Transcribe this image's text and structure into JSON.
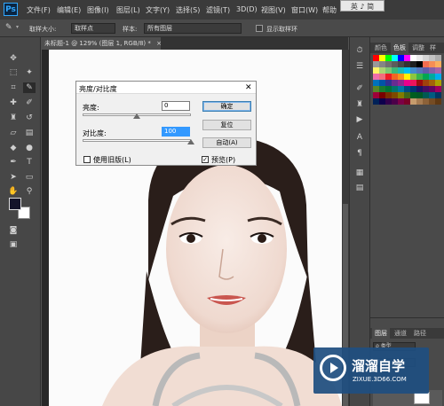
{
  "menubar": {
    "logo": "Ps",
    "items": [
      "文件(F)",
      "编辑(E)",
      "图像(I)",
      "图层(L)",
      "文字(Y)",
      "选择(S)",
      "滤镜(T)",
      "3D(D)",
      "视图(V)",
      "窗口(W)",
      "帮助"
    ],
    "tooltip": "英 ♪ 简"
  },
  "options": {
    "sample_size_label": "取样大小:",
    "sample_size_value": "取样点",
    "sample_label": "样本:",
    "sample_value": "所有图层",
    "show_ring_label": "显示取样环"
  },
  "document": {
    "tab_title": "未标题-1 @ 129% (图层 1, RGB/8) *",
    "tab_close": "×"
  },
  "swatches": {
    "tabs": [
      "颜色",
      "色板",
      "调整",
      "样式"
    ],
    "colors": [
      "#ff0000",
      "#ffff00",
      "#00ff00",
      "#00ffff",
      "#0000ff",
      "#ff00ff",
      "#ffffff",
      "#ebebeb",
      "#d6d6d6",
      "#c2c2c2",
      "#adadad",
      "#999999",
      "#858585",
      "#707070",
      "#5c5c5c",
      "#474747",
      "#333333",
      "#1f1f1f",
      "#000000",
      "#f26c4f",
      "#f68e55",
      "#fbaf5c",
      "#fff467",
      "#acd372",
      "#7dc473",
      "#3cb878",
      "#1abbb4",
      "#00bff3",
      "#438ccb",
      "#5574b9",
      "#605ca8",
      "#855fa8",
      "#a763a8",
      "#f06ea9",
      "#f26d7d",
      "#ed1c24",
      "#f26522",
      "#f7941d",
      "#fff200",
      "#8dc63f",
      "#39b54a",
      "#00a651",
      "#00a99d",
      "#00aeef",
      "#0072bc",
      "#0054a6",
      "#2e3192",
      "#662d91",
      "#92278f",
      "#ec008c",
      "#ed145b",
      "#9e0b0f",
      "#a0410d",
      "#a3620a",
      "#aba000",
      "#598527",
      "#197b30",
      "#007236",
      "#00746b",
      "#0076a3",
      "#004a80",
      "#003471",
      "#1b1464",
      "#440e62",
      "#630460",
      "#9e005d",
      "#9e0039",
      "#790000",
      "#7b2e00",
      "#7d4900",
      "#827b00",
      "#406618",
      "#005e20",
      "#005826",
      "#005952",
      "#005b7f",
      "#003663",
      "#002157",
      "#0d004c",
      "#32004b",
      "#4b0049",
      "#7b0046",
      "#7a0026",
      "#c69c6d",
      "#a67c52",
      "#8c6239",
      "#754c24",
      "#603913"
    ]
  },
  "layers": {
    "tabs": [
      "图层",
      "通道",
      "路径"
    ],
    "kind_label": "ρ 类型",
    "opacity_label": "正常"
  },
  "dialog": {
    "title": "亮度/对比度",
    "close": "✕",
    "brightness_label": "亮度:",
    "brightness_value": "0",
    "contrast_label": "对比度:",
    "contrast_value": "100",
    "ok_label": "确定",
    "reset_label": "复位",
    "auto_label": "自动(A)",
    "legacy_label": "使用旧版(L)",
    "preview_label": "预览(P)",
    "brightness_fraction": 0.5,
    "contrast_fraction": 1.0
  },
  "watermark": {
    "title": "溜溜自学",
    "url": "ZIXUE.3D66.COM"
  }
}
